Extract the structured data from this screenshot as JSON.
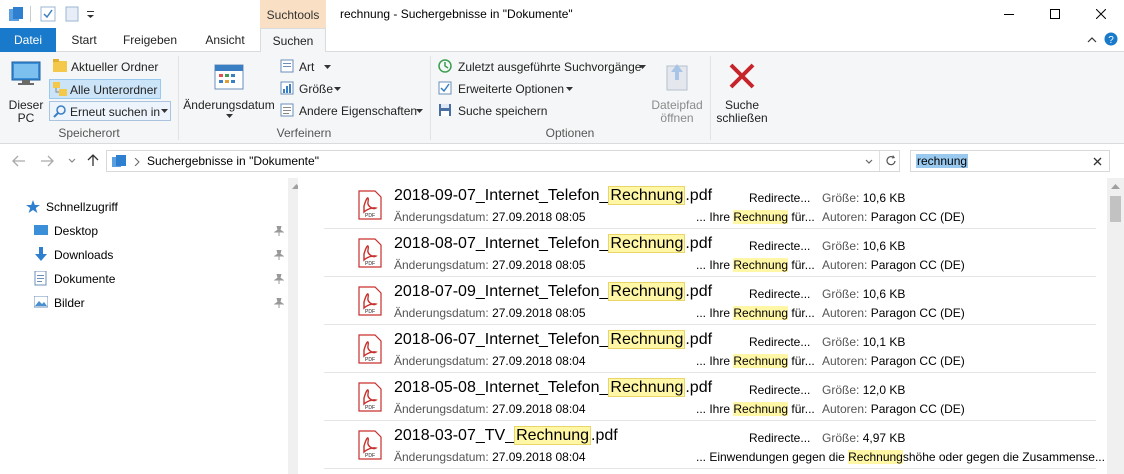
{
  "window": {
    "context_tab": "Suchtools",
    "title": "rechnung - Suchergebnisse in \"Dokumente\""
  },
  "tabs": {
    "datei": "Datei",
    "start": "Start",
    "freigeben": "Freigeben",
    "ansicht": "Ansicht",
    "suchen": "Suchen"
  },
  "ribbon": {
    "dieser_pc": [
      "Dieser",
      "PC"
    ],
    "aktueller_ordner": "Aktueller Ordner",
    "alle_unterordner": "Alle Unterordner",
    "erneut_suchen": "Erneut suchen in",
    "group_suchort": "Speicherort",
    "aenderungsdatum": "Änderungsdatum",
    "art": "Art",
    "groesse": "Größe",
    "andere_eigenschaften": "Andere Eigenschaften",
    "group_verfeinern": "Verfeinern",
    "zuletzt": "Zuletzt ausgeführte Suchvorgänge",
    "erweiterte": "Erweiterte Optionen",
    "suche_speichern": "Suche speichern",
    "dateipfad": [
      "Dateipfad",
      "öffnen"
    ],
    "group_optionen": "Optionen",
    "suche_schliessen": [
      "Suche",
      "schließen"
    ]
  },
  "address": {
    "path": "Suchergebnisse in \"Dokumente\"",
    "search_value": "rechnung"
  },
  "nav": {
    "schnellzugriff": "Schnellzugriff",
    "items": [
      "Desktop",
      "Downloads",
      "Dokumente",
      "Bilder"
    ]
  },
  "labels": {
    "aenderungsdatum": "Änderungsdatum:",
    "groesse": "Größe:",
    "autoren": "Autoren:",
    "redirecte": "Redirecte...",
    "highlight": "Rechnung"
  },
  "results": [
    {
      "prefix": "2018-09-07_Internet_Telefon_",
      "suffix": ".pdf",
      "date": "27.09.2018 08:05",
      "snippet_pre": "... Ihre ",
      "snippet_post": " für...",
      "size": "10,6 KB",
      "author": "Paragon CC (DE)"
    },
    {
      "prefix": "2018-08-07_Internet_Telefon_",
      "suffix": ".pdf",
      "date": "27.09.2018 08:05",
      "snippet_pre": "... Ihre ",
      "snippet_post": " für...",
      "size": "10,6 KB",
      "author": "Paragon CC (DE)"
    },
    {
      "prefix": "2018-07-09_Internet_Telefon_",
      "suffix": ".pdf",
      "date": "27.09.2018 08:05",
      "snippet_pre": "... Ihre ",
      "snippet_post": " für...",
      "size": "10,6 KB",
      "author": "Paragon CC (DE)"
    },
    {
      "prefix": "2018-06-07_Internet_Telefon_",
      "suffix": ".pdf",
      "date": "27.09.2018 08:04",
      "snippet_pre": "... Ihre ",
      "snippet_post": " für...",
      "size": "10,1 KB",
      "author": "Paragon CC (DE)"
    },
    {
      "prefix": "2018-05-08_Internet_Telefon_",
      "suffix": ".pdf",
      "date": "27.09.2018 08:04",
      "snippet_pre": "... Ihre ",
      "snippet_post": " für...",
      "size": "12,0 KB",
      "author": "Paragon CC (DE)"
    },
    {
      "prefix": "2018-03-07_TV_",
      "suffix": ".pdf",
      "date": "27.09.2018 08:04",
      "snippet_pre": "... Einwendungen gegen die ",
      "snippet_post": "shöhe oder gegen die Zusammense...",
      "size": "4,97 KB",
      "author": ""
    }
  ],
  "colors": {
    "accent": "#1979ca",
    "context_tab": "#f9e0c4",
    "highlight": "#fff7a5"
  }
}
